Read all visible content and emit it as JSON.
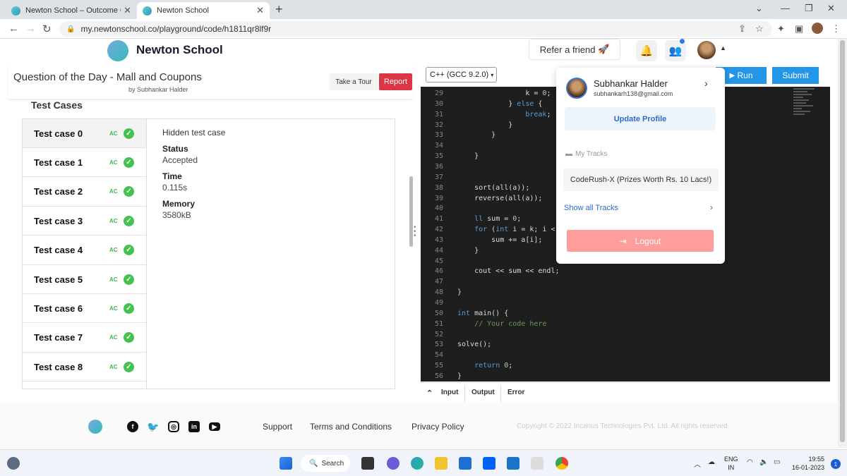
{
  "browser": {
    "tabs": [
      {
        "title": "Newton School – Outcome Orie",
        "active": false
      },
      {
        "title": "Newton School",
        "active": true
      }
    ],
    "url": "my.newtonschool.co/playground/code/h1811qr8lf9r"
  },
  "header": {
    "brand": "Newton School",
    "refer_label": "Refer a friend",
    "refer_icon": "🚀"
  },
  "question": {
    "title": "Question of the Day - Mall and Coupons",
    "author": "by Subhankar Halder",
    "tour_label": "Take a Tour",
    "report_label": "Report"
  },
  "test_cases": {
    "heading": "Test Cases",
    "status_tag": "AC",
    "items": [
      {
        "label": "Test case 0"
      },
      {
        "label": "Test case 1"
      },
      {
        "label": "Test case 2"
      },
      {
        "label": "Test case 3"
      },
      {
        "label": "Test case 4"
      },
      {
        "label": "Test case 5"
      },
      {
        "label": "Test case 6"
      },
      {
        "label": "Test case 7"
      },
      {
        "label": "Test case 8"
      }
    ],
    "detail": {
      "hidden_label": "Hidden test case",
      "status_label": "Status",
      "status_value": "Accepted",
      "time_label": "Time",
      "time_value": "0.115s",
      "memory_label": "Memory",
      "memory_value": "3580kB"
    }
  },
  "editor": {
    "language": "C++ (GCC 9.2.0)",
    "run_label": "Run",
    "submit_label": "Submit",
    "bottom_tabs": [
      "Input",
      "Output",
      "Error"
    ],
    "code_lines": [
      {
        "n": "29",
        "text": "                k = 0;"
      },
      {
        "n": "30",
        "text": "            } else {"
      },
      {
        "n": "31",
        "text": "                break;"
      },
      {
        "n": "32",
        "text": "            }"
      },
      {
        "n": "33",
        "text": "        }"
      },
      {
        "n": "34",
        "text": ""
      },
      {
        "n": "35",
        "text": "    }"
      },
      {
        "n": "36",
        "text": ""
      },
      {
        "n": "37",
        "text": ""
      },
      {
        "n": "38",
        "text": "    sort(all(a));"
      },
      {
        "n": "39",
        "text": "    reverse(all(a));"
      },
      {
        "n": "40",
        "text": ""
      },
      {
        "n": "41",
        "text": "    ll sum = 0;"
      },
      {
        "n": "42",
        "text": "    for (int i = k; i <"
      },
      {
        "n": "43",
        "text": "        sum += a[i];"
      },
      {
        "n": "44",
        "text": "    }"
      },
      {
        "n": "45",
        "text": ""
      },
      {
        "n": "46",
        "text": "    cout << sum << endl;"
      },
      {
        "n": "47",
        "text": ""
      },
      {
        "n": "48",
        "text": "}"
      },
      {
        "n": "49",
        "text": ""
      },
      {
        "n": "50",
        "text": "int main() {"
      },
      {
        "n": "51",
        "text": "    // Your code here"
      },
      {
        "n": "52",
        "text": ""
      },
      {
        "n": "53",
        "text": "solve();"
      },
      {
        "n": "54",
        "text": ""
      },
      {
        "n": "55",
        "text": "    return 0;"
      },
      {
        "n": "56",
        "text": "}"
      }
    ]
  },
  "profile_menu": {
    "name": "Subhankar Halder",
    "email": "subhankarh138@gmail.com",
    "update_label": "Update Profile",
    "tracks_label": "My Tracks",
    "track_item": "CodeRush-X (Prizes Worth Rs. 10 Lacs!)",
    "show_all_label": "Show all Tracks",
    "logout_label": "Logout"
  },
  "footer": {
    "links": [
      "Support",
      "Terms and Conditions",
      "Privacy Policy"
    ],
    "copyright": "Copyright © 2022 Incanus Technologies Pvt. Ltd. All rights reserved."
  },
  "taskbar": {
    "search_label": "Search",
    "lang_line1": "ENG",
    "lang_line2": "IN",
    "time": "19:55",
    "date": "16-01-2023",
    "notif_count": "1"
  }
}
